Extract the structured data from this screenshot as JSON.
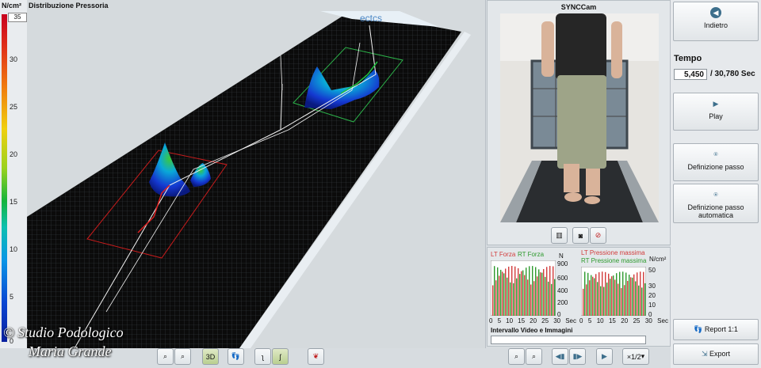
{
  "scale": {
    "unit": "N/cm²",
    "max_value": "35",
    "ticks": [
      "30",
      "25",
      "20",
      "15",
      "10",
      "5",
      "0"
    ]
  },
  "main": {
    "title": "Distribuzione Pressoria",
    "plot_brand": "ectcs"
  },
  "toolbar": {
    "view_3d_label": "3D"
  },
  "cam": {
    "title": "SYNCCam"
  },
  "graphs": {
    "left": {
      "lt_label": "LT Forza",
      "rt_label": "RT Forza",
      "unit": "N",
      "y_ticks": [
        "900",
        "600",
        "400",
        "200",
        "0"
      ],
      "x_ticks": [
        "0",
        "5",
        "10",
        "15",
        "20",
        "25",
        "30"
      ],
      "x_unit": "Sec",
      "lt_color": "#d23c3c",
      "rt_color": "#2e9a2e"
    },
    "right": {
      "lt_label": "LT Pressione massima",
      "rt_label": "RT Pressione massima",
      "unit": "N/cm²",
      "y_ticks": [
        "50",
        "30",
        "20",
        "10",
        "0"
      ],
      "x_ticks": [
        "0",
        "5",
        "10",
        "15",
        "20",
        "25",
        "30"
      ],
      "x_unit": "Sec",
      "lt_color": "#d23c3c",
      "rt_color": "#2e9a2e"
    },
    "interval_label": "Intervallo Video e Immagini"
  },
  "playback": {
    "speed": "×1/2"
  },
  "side": {
    "back_label": "Indietro",
    "tempo_label": "Tempo",
    "tempo_current": "5,450",
    "tempo_total": "/ 30,780 Sec",
    "play_label": "Play",
    "step_label": "Definizione passo",
    "auto_step_label": "Definizione passo automatica",
    "report_label": "Report 1:1",
    "export_label": "Export"
  },
  "watermark": {
    "line1": "© Studio Podologico",
    "line2": "Maria Grande"
  }
}
